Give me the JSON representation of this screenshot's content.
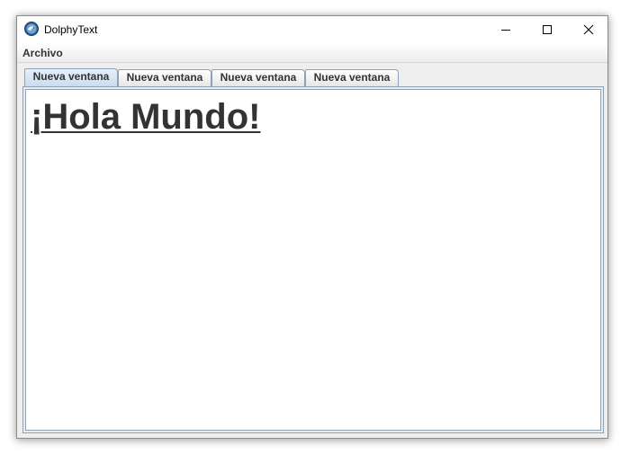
{
  "window": {
    "title": "DolphyText"
  },
  "menubar": {
    "items": [
      "Archivo"
    ]
  },
  "tabs": [
    {
      "label": "Nueva ventana",
      "selected": true
    },
    {
      "label": "Nueva ventana",
      "selected": false
    },
    {
      "label": "Nueva ventana",
      "selected": false
    },
    {
      "label": "Nueva ventana",
      "selected": false
    }
  ],
  "editor": {
    "heading": "¡Hola Mundo!"
  },
  "icons": {
    "app": "dolphin-globe-icon",
    "minimize": "minimize-icon",
    "maximize": "maximize-icon",
    "close": "close-icon"
  },
  "colors": {
    "selected_tab": "#c9dcf0",
    "tab_border": "#8ea2b8",
    "heading_text": "#333333"
  }
}
